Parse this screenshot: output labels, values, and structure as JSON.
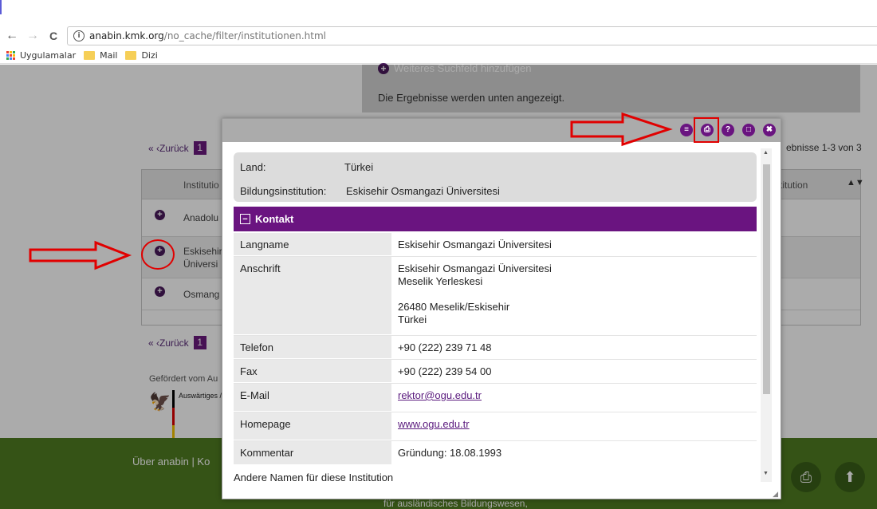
{
  "browser": {
    "back_icon": "←",
    "forward_icon": "→",
    "reload_icon": "C",
    "info_icon": "i",
    "url_host": "anabin.kmk.org",
    "url_path": "/no_cache/filter/institutionen.html",
    "bookmarks": [
      {
        "label": "Uygulamalar"
      },
      {
        "label": "Mail"
      },
      {
        "label": "Dizi"
      }
    ]
  },
  "page": {
    "add_field": "Weiteres Suchfeld hinzufügen",
    "results_note": "Die Ergebnisse werden unten angezeigt.",
    "pager_back": "« ‹Zurück",
    "pager_current": "1",
    "results_count": "ebnisse 1-3 von 3",
    "table_head_left": "Institutio",
    "table_head_right": "titution",
    "sort_icon": "▲▼",
    "rows": [
      {
        "text": "Anadolu"
      },
      {
        "text": "Eskisehir Üniversi"
      },
      {
        "text": "Osmang"
      }
    ],
    "funded_by": "Gefördert vom Au",
    "ministry_label": "Auswärtiges /",
    "footer_links": "Über anabin | Ko",
    "footer_sub": "für ausländisches Bildungswesen,"
  },
  "modal": {
    "toolbar_icons": [
      "≡",
      "⎙",
      "?",
      "□",
      "✖"
    ],
    "summary": [
      {
        "key": "Land:",
        "value": "Türkei"
      },
      {
        "key": "Bildungsinstitution:",
        "value": "Eskisehir Osmangazi Üniversitesi"
      }
    ],
    "section_title": "Kontakt",
    "contact": {
      "langname_label": "Langname",
      "langname": "Eskisehir Osmangazi Üniversitesi",
      "anschrift_label": "Anschrift",
      "anschrift_line1": "Eskisehir Osmangazi Üniversitesi",
      "anschrift_line2": "Meselik Yerleskesi",
      "anschrift_line3": "26480 Meselik/Eskisehir",
      "anschrift_line4": "Türkei",
      "telefon_label": "Telefon",
      "telefon": "+90 (222) 239 71 48",
      "fax_label": "Fax",
      "fax": "+90 (222) 239 54 00",
      "email_label": "E-Mail",
      "email": "rektor@ogu.edu.tr",
      "homepage_label": "Homepage",
      "homepage": "www.ogu.edu.tr",
      "kommentar_label": "Kommentar",
      "kommentar": "Gründung: 18.08.1993"
    },
    "other_names": "Andere Namen für diese Institution"
  },
  "colors": {
    "accent_purple": "#6a1480",
    "footer_green": "#4f7c21",
    "annotation_red": "#e10000"
  }
}
